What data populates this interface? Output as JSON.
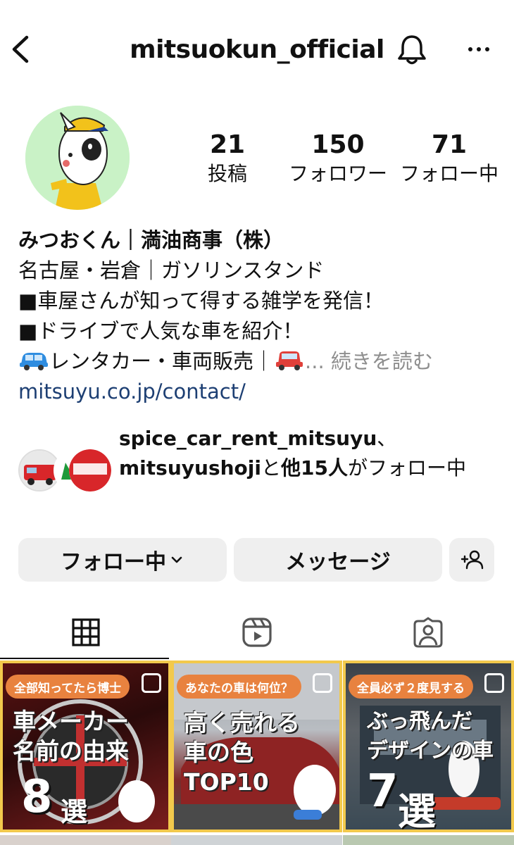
{
  "header": {
    "title": "mitsuokun_official"
  },
  "stats": {
    "posts": {
      "value": "21",
      "label": "投稿"
    },
    "followers": {
      "value": "150",
      "label": "フォロワー"
    },
    "following": {
      "value": "71",
      "label": "フォロー中"
    }
  },
  "bio": {
    "name": "みつおくん｜満油商事（株）",
    "line1": "名古屋・岩倉｜ガソリンスタンド",
    "line2": "■車屋さんが知って得する雑学を発信！",
    "line3": "■ドライブで人気な車を紹介！",
    "line4": "レンタカー・車両販売｜",
    "more_label": "... 続きを読む",
    "link": "mitsuyu.co.jp/contact/"
  },
  "followed_by": {
    "user1": "spice_car_rent_mitsuyu",
    "sep": "、",
    "user2": "mitsuyushoji",
    "mid": "と",
    "others": "他15人",
    "suffix": "がフォロー中"
  },
  "buttons": {
    "following": "フォロー中",
    "message": "メッセージ"
  },
  "posts": [
    {
      "tag": "全部知ってたら博士",
      "headline": "車メーカー\n名前の由来",
      "big": "8",
      "big_sub": "選"
    },
    {
      "tag": "あなたの車は何位？",
      "headline": "高く売れる\n車の色\nTOP10"
    },
    {
      "tag": "全員必ず２度見する",
      "headline": "ぶっ飛んだ\nデザインの車",
      "big": "7",
      "big_sub": "選"
    }
  ],
  "colors": {
    "link": "#1d3f73",
    "button_bg": "#efefef",
    "post_tag": "#e8823f",
    "post_border": "#f2c94c",
    "avatar_bg": "#c9f2c6"
  },
  "icons": [
    "back-arrow-icon",
    "bell-icon",
    "more-icon",
    "add-user-icon",
    "grid-icon",
    "reels-icon",
    "tagged-icon",
    "chevron-down-icon"
  ]
}
